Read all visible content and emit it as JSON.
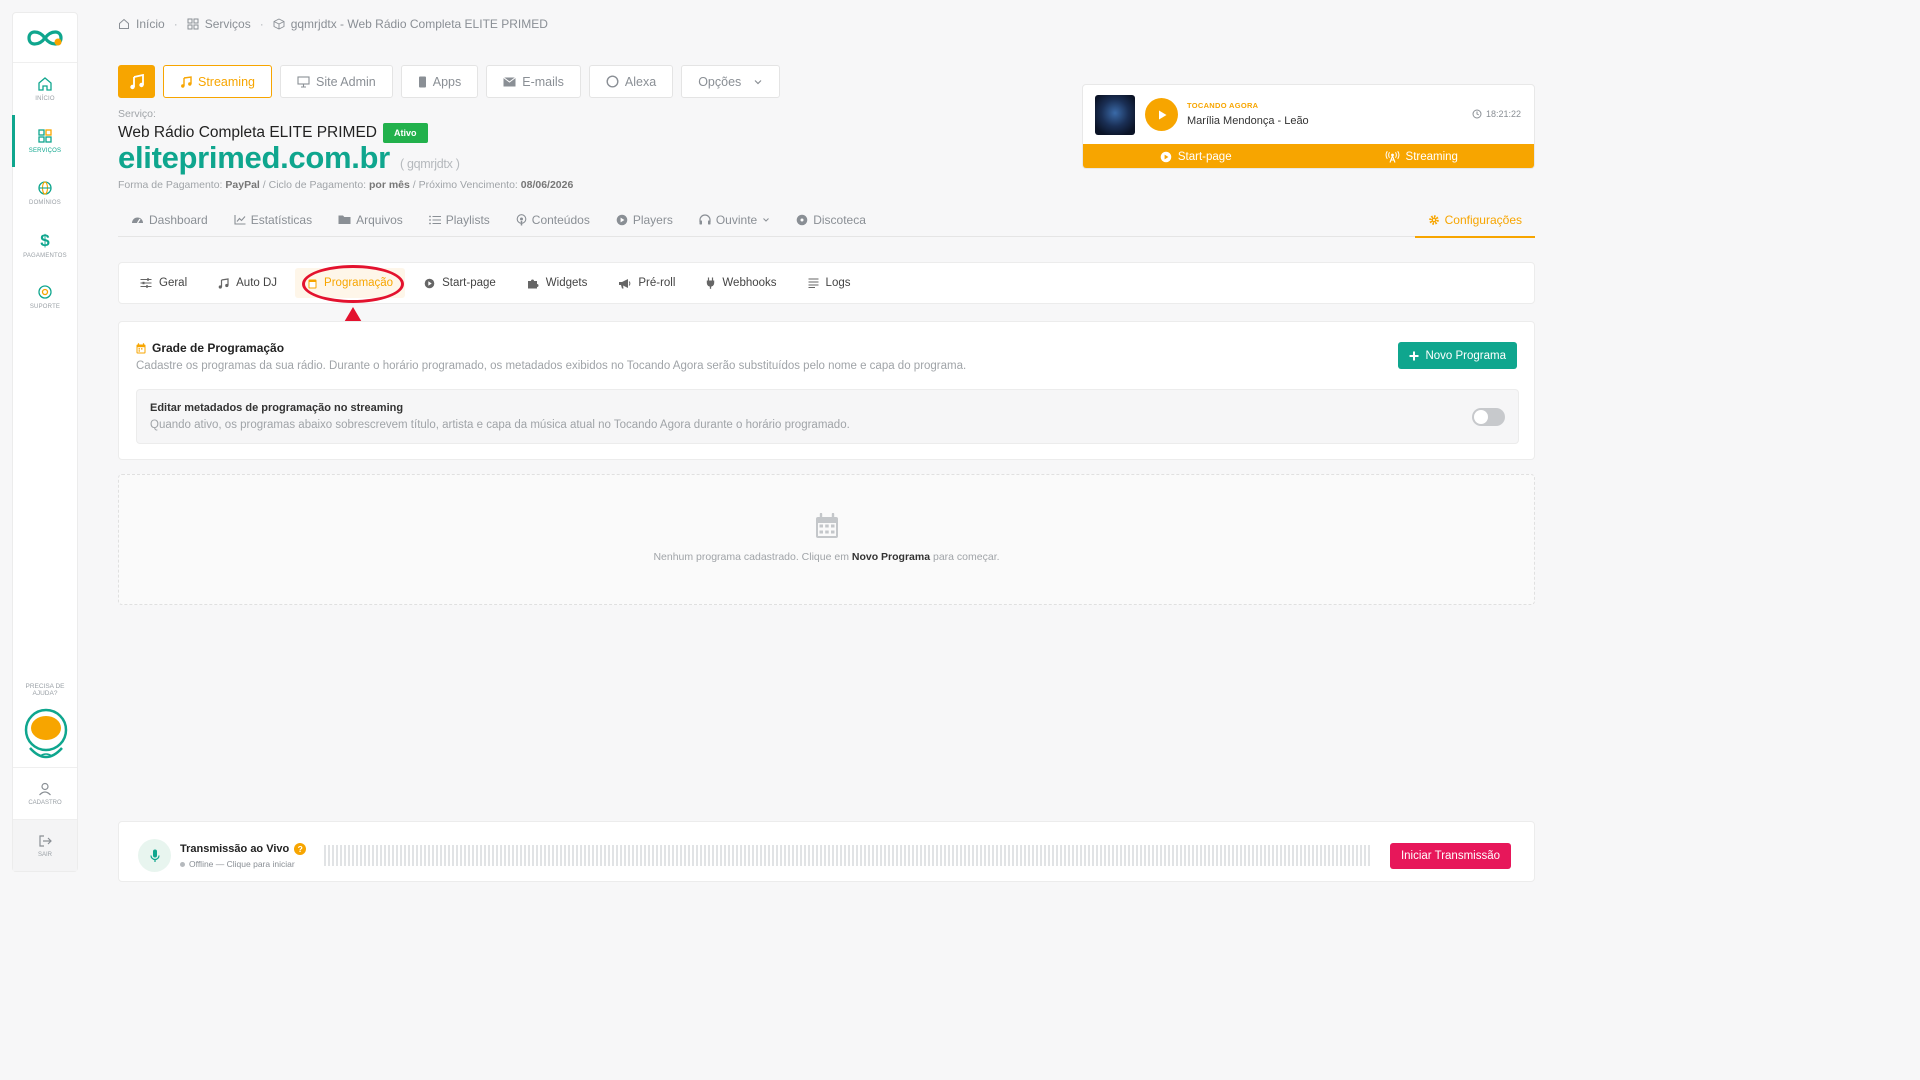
{
  "sidebar": {
    "items": [
      {
        "label": "INÍCIO",
        "icon": "home-icon"
      },
      {
        "label": "SERVIÇOS",
        "icon": "grid-icon"
      },
      {
        "label": "DOMÍNIOS",
        "icon": "globe-icon"
      },
      {
        "label": "PAGAMENTOS",
        "icon": "dollar-icon"
      },
      {
        "label": "SUPORTE",
        "icon": "lifebuoy-icon"
      }
    ],
    "help_line1": "PRECISA DE",
    "help_line2": "AJUDA?",
    "account_label": "CADASTRO",
    "logout_label": "SAIR"
  },
  "breadcrumb": {
    "home": "Início",
    "services": "Serviços",
    "current": "gqmrjdtx - Web Rádio Completa ELITE PRIMED"
  },
  "toolbar": {
    "streaming": "Streaming",
    "site_admin": "Site Admin",
    "apps": "Apps",
    "emails": "E-mails",
    "alexa": "Alexa",
    "options": "Opções"
  },
  "service": {
    "label": "Serviço:",
    "name": "Web Rádio Completa ELITE PRIMED",
    "status": "Ativo",
    "domain": "eliteprimed.com.br",
    "code": "( gqmrjdtx )",
    "payment_method_label": "Forma de Pagamento:",
    "payment_method": "PayPal",
    "cycle_label": "/ Ciclo de Pagamento:",
    "cycle": "por mês",
    "due_label": "/ Próximo Vencimento:",
    "due_date": "08/06/2026"
  },
  "now_playing": {
    "label": "TOCANDO AGORA",
    "song": "Marília Mendonça - Leão",
    "time": "18:21:22",
    "startpage": "Start-page",
    "streaming": "Streaming"
  },
  "main_tabs": {
    "dashboard": "Dashboard",
    "stats": "Estatísticas",
    "files": "Arquivos",
    "playlists": "Playlists",
    "contents": "Conteúdos",
    "players": "Players",
    "listener": "Ouvinte",
    "library": "Discoteca",
    "settings": "Configurações"
  },
  "sub_tabs": {
    "general": "Geral",
    "autodj": "Auto DJ",
    "schedule": "Programação",
    "startpage": "Start-page",
    "widgets": "Widgets",
    "preroll": "Pré-roll",
    "webhooks": "Webhooks",
    "logs": "Logs"
  },
  "grade": {
    "title": "Grade de Programação",
    "description": "Cadastre os programas da sua rádio. Durante o horário programado, os metadados exibidos no Tocando Agora serão substituídos pelo nome e capa do programa.",
    "new_button": "Novo Programa",
    "meta_title": "Editar metadados de programação no streaming",
    "meta_desc": "Quando ativo, os programas abaixo sobrescrevem título, artista e capa da música atual no Tocando Agora durante o horário programado.",
    "meta_enabled": false
  },
  "empty": {
    "before": "Nenhum programa cadastrado. Clique em",
    "bold": "Novo Programa",
    "after": "para começar."
  },
  "live": {
    "title": "Transmissão ao Vivo",
    "status": "Offline — Clique para iniciar",
    "button": "Iniciar Transmissão"
  },
  "colors": {
    "accent_orange": "#f7a500",
    "brand_teal": "#0fa68e",
    "danger_red": "#e7175a",
    "annotation_red": "#e3122e"
  }
}
